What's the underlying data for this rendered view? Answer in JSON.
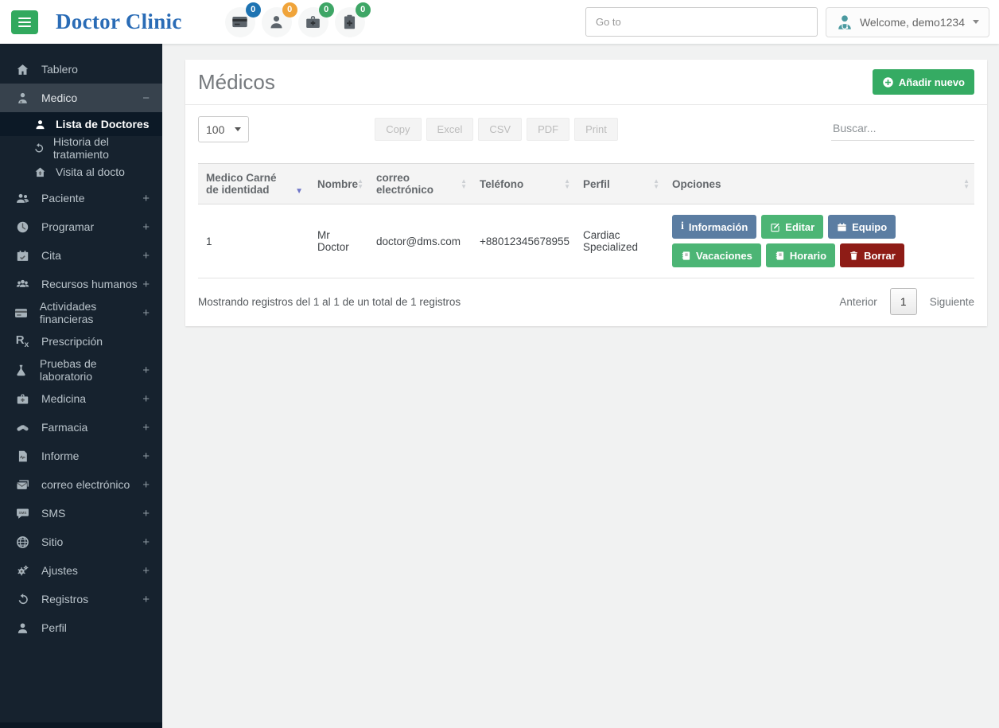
{
  "header": {
    "brand": "Doctor Clinic",
    "goto_placeholder": "Go to",
    "user": {
      "label": "Welcome, demo1234",
      "avatar_icon": "doctor-avatar-icon"
    },
    "notifications": [
      {
        "icon": "billing-card-icon",
        "count": "0",
        "color": "#1d73b2"
      },
      {
        "icon": "patient-icon",
        "count": "0",
        "color": "#f0a43a"
      },
      {
        "icon": "medical-bag-icon",
        "count": "0",
        "color": "#3ea666"
      },
      {
        "icon": "clipboard-plus-icon",
        "count": "0",
        "color": "#3ea666"
      }
    ]
  },
  "sidebar": {
    "items": [
      {
        "label": "Tablero",
        "icon": "home-icon"
      },
      {
        "label": "Medico",
        "icon": "doctor-icon",
        "toggle": "−",
        "expanded": true,
        "children": [
          {
            "label": "Lista de Doctores",
            "icon": "person-icon",
            "active": true
          },
          {
            "label": "Historia del tratamiento",
            "icon": "history-icon"
          },
          {
            "label": "Visita al docto",
            "icon": "home-visit-icon"
          }
        ]
      },
      {
        "label": "Paciente",
        "icon": "patients-icon",
        "toggle": "+"
      },
      {
        "label": "Programar",
        "icon": "clock-icon",
        "toggle": "+"
      },
      {
        "label": "Cita",
        "icon": "calendar-check-icon",
        "toggle": "+"
      },
      {
        "label": "Recursos humanos",
        "icon": "team-icon",
        "toggle": "+"
      },
      {
        "label": "Actividades financieras",
        "icon": "credit-card-icon",
        "toggle": "+"
      },
      {
        "label": "Prescripción",
        "icon": "rx-icon"
      },
      {
        "label": "Pruebas de laboratorio",
        "icon": "flask-icon",
        "toggle": "+"
      },
      {
        "label": "Medicina",
        "icon": "medical-bag-icon",
        "toggle": "+"
      },
      {
        "label": "Farmacia",
        "icon": "pills-icon",
        "toggle": "+"
      },
      {
        "label": "Informe",
        "icon": "report-icon",
        "toggle": "+"
      },
      {
        "label": "correo electrónico",
        "icon": "mail-icon",
        "toggle": "+"
      },
      {
        "label": "SMS",
        "icon": "sms-icon",
        "toggle": "+"
      },
      {
        "label": "Sitio",
        "icon": "globe-icon",
        "toggle": "+"
      },
      {
        "label": "Ajustes",
        "icon": "gears-icon",
        "toggle": "+"
      },
      {
        "label": "Registros",
        "icon": "history-icon",
        "toggle": "+"
      },
      {
        "label": "Perfil",
        "icon": "person-icon"
      }
    ]
  },
  "main": {
    "title": "Médicos",
    "add_button": "Añadir nuevo",
    "length_value": "100",
    "export_buttons": [
      "Copy",
      "Excel",
      "CSV",
      "PDF",
      "Print"
    ],
    "search_placeholder": "Buscar...",
    "table": {
      "columns": [
        "Medico Carné de identidad",
        "Nombre",
        "correo electrónico",
        "Teléfono",
        "Perfil",
        "Opciones"
      ],
      "rows": [
        {
          "id": "1",
          "name": "Mr Doctor",
          "email": "doctor@dms.com",
          "phone": "+88012345678955",
          "profile": "Cardiac Specialized",
          "actions": [
            {
              "label": "Información",
              "style": "blue",
              "icon": "info-icon"
            },
            {
              "label": "Editar",
              "style": "green",
              "icon": "edit-icon"
            },
            {
              "label": "Equipo",
              "style": "blue",
              "icon": "calendar-icon"
            },
            {
              "label": "Vacaciones",
              "style": "green",
              "icon": "address-book-icon"
            },
            {
              "label": "Horario",
              "style": "green",
              "icon": "address-book-icon"
            },
            {
              "label": "Borrar",
              "style": "red",
              "icon": "trash-icon"
            }
          ]
        }
      ]
    },
    "footer": {
      "info": "Mostrando registros del 1 al 1 de un total de 1 registros",
      "prev": "Anterior",
      "page": "1",
      "next": "Siguiente"
    }
  },
  "colors": {
    "sidebar_bg": "#16222e",
    "sidebar_active_bg": "#0c1926",
    "sidebar_open_bg": "#37424d",
    "brand_blue": "#2a6cb6",
    "green": "#35ab63",
    "action_green": "#4cb575",
    "action_blue": "#5b7da2",
    "action_red": "#8e1c16",
    "badge_blue": "#1d73b2",
    "badge_orange": "#f0a43a",
    "badge_green": "#3ea666",
    "avatar_teal": "#4b9aa0",
    "sort_active": "#6f76c8",
    "page_bg": "#f1f2f2"
  }
}
